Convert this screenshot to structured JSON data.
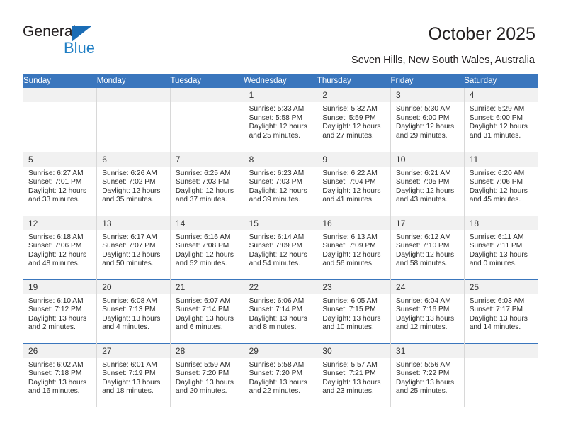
{
  "brand": {
    "name_top": "General",
    "name_bottom": "Blue",
    "accent_color": "#1f7ec4",
    "triangle_color": "#1a6cb5"
  },
  "header": {
    "title": "October 2025",
    "subtitle": "Seven Hills, New South Wales, Australia"
  },
  "calendar": {
    "header_bg": "#3a76bd",
    "daystrip_bg": "#f1f1f1",
    "weekdays": [
      "Sunday",
      "Monday",
      "Tuesday",
      "Wednesday",
      "Thursday",
      "Friday",
      "Saturday"
    ],
    "labels": {
      "sunrise": "Sunrise:",
      "sunset": "Sunset:",
      "daylight": "Daylight:"
    },
    "weeks": [
      [
        {
          "day": "",
          "empty": true
        },
        {
          "day": "",
          "empty": true
        },
        {
          "day": "",
          "empty": true
        },
        {
          "day": "1",
          "sunrise": "Sunrise: 5:33 AM",
          "sunset": "Sunset: 5:58 PM",
          "daylight": "Daylight: 12 hours and 25 minutes."
        },
        {
          "day": "2",
          "sunrise": "Sunrise: 5:32 AM",
          "sunset": "Sunset: 5:59 PM",
          "daylight": "Daylight: 12 hours and 27 minutes."
        },
        {
          "day": "3",
          "sunrise": "Sunrise: 5:30 AM",
          "sunset": "Sunset: 6:00 PM",
          "daylight": "Daylight: 12 hours and 29 minutes."
        },
        {
          "day": "4",
          "sunrise": "Sunrise: 5:29 AM",
          "sunset": "Sunset: 6:00 PM",
          "daylight": "Daylight: 12 hours and 31 minutes."
        }
      ],
      [
        {
          "day": "5",
          "sunrise": "Sunrise: 6:27 AM",
          "sunset": "Sunset: 7:01 PM",
          "daylight": "Daylight: 12 hours and 33 minutes."
        },
        {
          "day": "6",
          "sunrise": "Sunrise: 6:26 AM",
          "sunset": "Sunset: 7:02 PM",
          "daylight": "Daylight: 12 hours and 35 minutes."
        },
        {
          "day": "7",
          "sunrise": "Sunrise: 6:25 AM",
          "sunset": "Sunset: 7:03 PM",
          "daylight": "Daylight: 12 hours and 37 minutes."
        },
        {
          "day": "8",
          "sunrise": "Sunrise: 6:23 AM",
          "sunset": "Sunset: 7:03 PM",
          "daylight": "Daylight: 12 hours and 39 minutes."
        },
        {
          "day": "9",
          "sunrise": "Sunrise: 6:22 AM",
          "sunset": "Sunset: 7:04 PM",
          "daylight": "Daylight: 12 hours and 41 minutes."
        },
        {
          "day": "10",
          "sunrise": "Sunrise: 6:21 AM",
          "sunset": "Sunset: 7:05 PM",
          "daylight": "Daylight: 12 hours and 43 minutes."
        },
        {
          "day": "11",
          "sunrise": "Sunrise: 6:20 AM",
          "sunset": "Sunset: 7:06 PM",
          "daylight": "Daylight: 12 hours and 45 minutes."
        }
      ],
      [
        {
          "day": "12",
          "sunrise": "Sunrise: 6:18 AM",
          "sunset": "Sunset: 7:06 PM",
          "daylight": "Daylight: 12 hours and 48 minutes."
        },
        {
          "day": "13",
          "sunrise": "Sunrise: 6:17 AM",
          "sunset": "Sunset: 7:07 PM",
          "daylight": "Daylight: 12 hours and 50 minutes."
        },
        {
          "day": "14",
          "sunrise": "Sunrise: 6:16 AM",
          "sunset": "Sunset: 7:08 PM",
          "daylight": "Daylight: 12 hours and 52 minutes."
        },
        {
          "day": "15",
          "sunrise": "Sunrise: 6:14 AM",
          "sunset": "Sunset: 7:09 PM",
          "daylight": "Daylight: 12 hours and 54 minutes."
        },
        {
          "day": "16",
          "sunrise": "Sunrise: 6:13 AM",
          "sunset": "Sunset: 7:09 PM",
          "daylight": "Daylight: 12 hours and 56 minutes."
        },
        {
          "day": "17",
          "sunrise": "Sunrise: 6:12 AM",
          "sunset": "Sunset: 7:10 PM",
          "daylight": "Daylight: 12 hours and 58 minutes."
        },
        {
          "day": "18",
          "sunrise": "Sunrise: 6:11 AM",
          "sunset": "Sunset: 7:11 PM",
          "daylight": "Daylight: 13 hours and 0 minutes."
        }
      ],
      [
        {
          "day": "19",
          "sunrise": "Sunrise: 6:10 AM",
          "sunset": "Sunset: 7:12 PM",
          "daylight": "Daylight: 13 hours and 2 minutes."
        },
        {
          "day": "20",
          "sunrise": "Sunrise: 6:08 AM",
          "sunset": "Sunset: 7:13 PM",
          "daylight": "Daylight: 13 hours and 4 minutes."
        },
        {
          "day": "21",
          "sunrise": "Sunrise: 6:07 AM",
          "sunset": "Sunset: 7:14 PM",
          "daylight": "Daylight: 13 hours and 6 minutes."
        },
        {
          "day": "22",
          "sunrise": "Sunrise: 6:06 AM",
          "sunset": "Sunset: 7:14 PM",
          "daylight": "Daylight: 13 hours and 8 minutes."
        },
        {
          "day": "23",
          "sunrise": "Sunrise: 6:05 AM",
          "sunset": "Sunset: 7:15 PM",
          "daylight": "Daylight: 13 hours and 10 minutes."
        },
        {
          "day": "24",
          "sunrise": "Sunrise: 6:04 AM",
          "sunset": "Sunset: 7:16 PM",
          "daylight": "Daylight: 13 hours and 12 minutes."
        },
        {
          "day": "25",
          "sunrise": "Sunrise: 6:03 AM",
          "sunset": "Sunset: 7:17 PM",
          "daylight": "Daylight: 13 hours and 14 minutes."
        }
      ],
      [
        {
          "day": "26",
          "sunrise": "Sunrise: 6:02 AM",
          "sunset": "Sunset: 7:18 PM",
          "daylight": "Daylight: 13 hours and 16 minutes."
        },
        {
          "day": "27",
          "sunrise": "Sunrise: 6:01 AM",
          "sunset": "Sunset: 7:19 PM",
          "daylight": "Daylight: 13 hours and 18 minutes."
        },
        {
          "day": "28",
          "sunrise": "Sunrise: 5:59 AM",
          "sunset": "Sunset: 7:20 PM",
          "daylight": "Daylight: 13 hours and 20 minutes."
        },
        {
          "day": "29",
          "sunrise": "Sunrise: 5:58 AM",
          "sunset": "Sunset: 7:20 PM",
          "daylight": "Daylight: 13 hours and 22 minutes."
        },
        {
          "day": "30",
          "sunrise": "Sunrise: 5:57 AM",
          "sunset": "Sunset: 7:21 PM",
          "daylight": "Daylight: 13 hours and 23 minutes."
        },
        {
          "day": "31",
          "sunrise": "Sunrise: 5:56 AM",
          "sunset": "Sunset: 7:22 PM",
          "daylight": "Daylight: 13 hours and 25 minutes."
        },
        {
          "day": "",
          "empty": true
        }
      ]
    ]
  }
}
